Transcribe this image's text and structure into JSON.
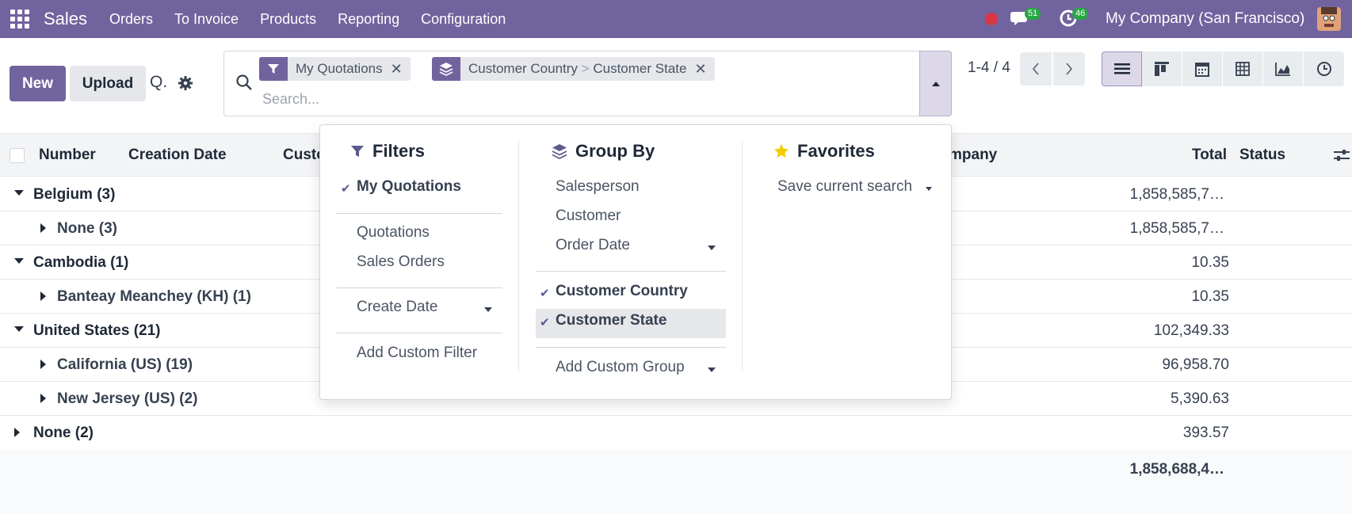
{
  "topbar": {
    "app_name": "Sales",
    "menu": [
      "Orders",
      "To Invoice",
      "Products",
      "Reporting",
      "Configuration"
    ],
    "messages_count": "51",
    "activities_count": "46",
    "company": "My Company (San Francisco)"
  },
  "control": {
    "new_label": "New",
    "upload_label": "Upload",
    "view_title": "Q."
  },
  "search": {
    "placeholder": "Search...",
    "facets": [
      {
        "label": "My Quotations",
        "icon": "filter-icon"
      },
      {
        "group_1": "Customer Country",
        "separator": ">",
        "group_2": "Customer State",
        "icon": "layers-icon"
      }
    ]
  },
  "pager": {
    "value": "1-4 / 4"
  },
  "list": {
    "headers": {
      "number": "Number",
      "creation_date": "Creation Date",
      "customer": "Custo",
      "company": "mpany",
      "total": "Total",
      "status": "Status"
    },
    "rows": [
      {
        "label": "Belgium (3)",
        "total": "1,858,585,7…",
        "level": 0,
        "expanded": true
      },
      {
        "label": "None (3)",
        "total": "1,858,585,7…",
        "level": 1,
        "expanded": false
      },
      {
        "label": "Cambodia (1)",
        "total": "10.35",
        "level": 0,
        "expanded": true
      },
      {
        "label": "Banteay Meanchey (KH) (1)",
        "total": "10.35",
        "level": 1,
        "expanded": false
      },
      {
        "label": "United States (21)",
        "total": "102,349.33",
        "level": 0,
        "expanded": true
      },
      {
        "label": "California (US) (19)",
        "total": "96,958.70",
        "level": 1,
        "expanded": false
      },
      {
        "label": "New Jersey (US) (2)",
        "total": "5,390.63",
        "level": 1,
        "expanded": false
      },
      {
        "label": "None (2)",
        "total": "393.57",
        "level": 0,
        "expanded": false
      }
    ],
    "grand_total": "1,858,688,4…"
  },
  "dropdown": {
    "filters": {
      "title": "Filters",
      "my_quotations": "My Quotations",
      "quotations": "Quotations",
      "sales_orders": "Sales Orders",
      "create_date": "Create Date",
      "add_custom_filter": "Add Custom Filter"
    },
    "group_by": {
      "title": "Group By",
      "salesperson": "Salesperson",
      "customer": "Customer",
      "order_date": "Order Date",
      "customer_country": "Customer Country",
      "customer_state": "Customer State",
      "add_custom_group": "Add Custom Group"
    },
    "favorites": {
      "title": "Favorites",
      "save_current_search": "Save current search"
    }
  },
  "colors": {
    "brand": "#71639e",
    "badge": "#28a745",
    "record": "#dc3545",
    "star": "#f3cc00"
  }
}
